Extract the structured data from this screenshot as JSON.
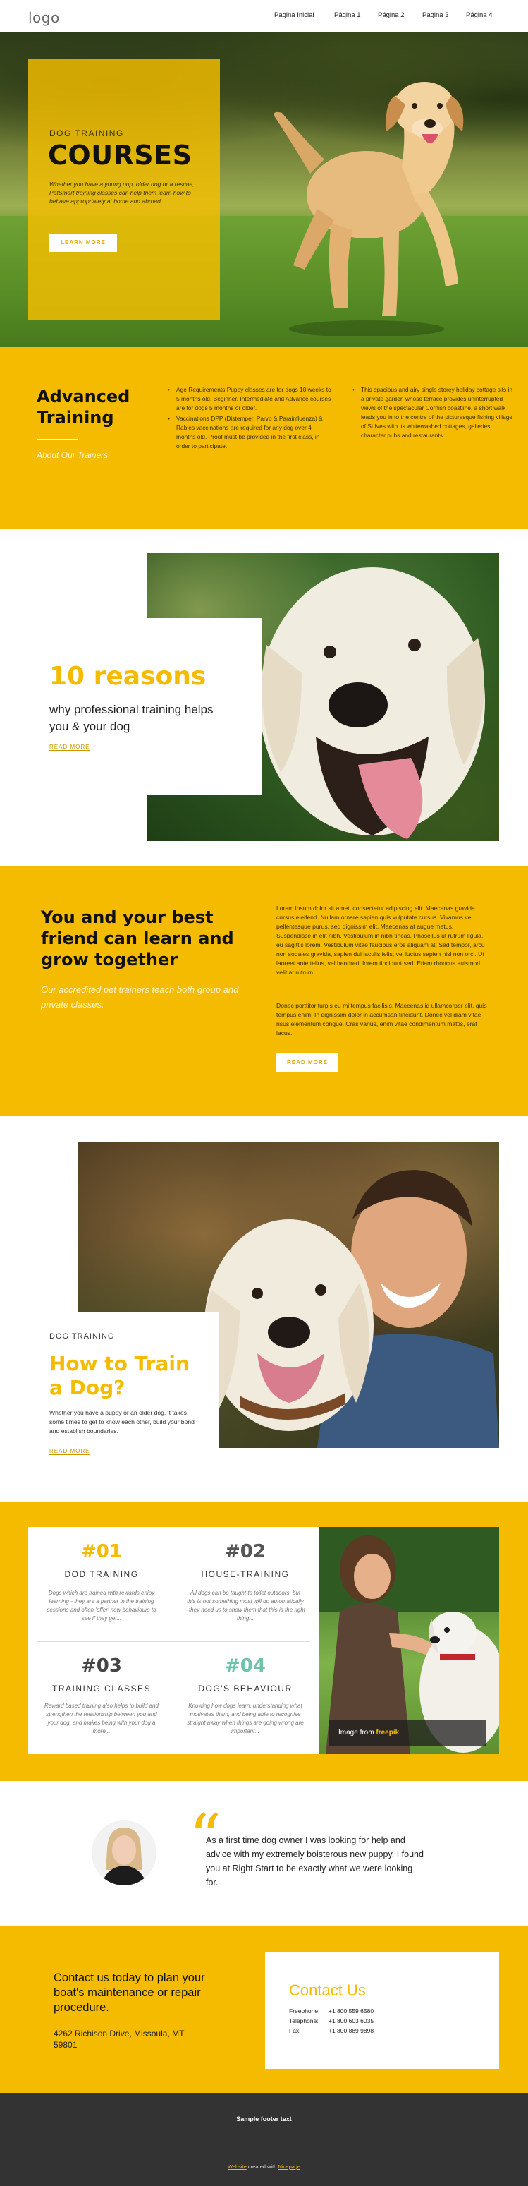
{
  "header": {
    "logo": "logo",
    "nav": [
      "Página Inicial",
      "Página 1",
      "Página 2",
      "Página 3",
      "Página 4"
    ]
  },
  "hero": {
    "eyebrow": "DOG TRAINING",
    "title": "COURSES",
    "text": "Whether you have a young pup, older dog or a rescue, PetSmart training classes can help them learn how to behave appropriately at home and abroad.",
    "button": "LEARN MORE"
  },
  "advanced": {
    "title": "Advanced Training",
    "link": "About Our Trainers",
    "list1": [
      "Age Requirements Puppy classes are for dogs 10 weeks to 5 months old. Beginner, Intermediate and Advance courses are for dogs 5 months or older.",
      "Vaccinations DPP (Distemper, Parvo & Parainfluenza) & Rabies vaccinations are required for any dog over 4 months old. Proof must be provided in the first class, in order to participate."
    ],
    "list2": [
      "This spacious and airy single storey holiday cottage sits in a private garden whose terrace provides uninterrupted views of the spectacular Cornish coastline, a short walk leads you in to the centre of the picturesque fishing village of St Ives with its whitewashed cottages, galleries character pubs and restaurants."
    ]
  },
  "reasons": {
    "title": "10 reasons",
    "text": "why professional training helps you & your dog",
    "link": "READ MORE"
  },
  "learn": {
    "title": "You and your best friend can learn and grow together",
    "subtitle": "Our accredited pet trainers teach both group and private classes.",
    "p1": "Lorem ipsum dolor sit amet, consectetur adipiscing elit. Maecenas gravida cursus eleifend. Nullam ornare sapien quis vulputate cursus. Vivamus vel pellentesque purus, sed dignissim elit. Maecenas at augue metus. Suspendisse in elit nibh. Vestibulum in nibh tincas. Phasellus ut rutrum ligula, eu sagittis lorem. Vestibulum vitae faucibus eros aliquam at. Sed tempor, arcu non sodales gravida, sapien dui iaculis felis, vel luctus sapien nisl non orci. Ut laoreet ante tellus, vel hendrerit lorem tincidunt sed. Etiam rhoncus euismod velit at rutrum.",
    "p2": "Donec porttitor turpis eu mi tempus facilisis. Maecenas id ullamcorper elit, quis tempus enim. In dignissim dolor in accumsan tincidunt. Donec vel diam vitae risus elementum congue. Cras varius, enim vitae condimentum mattis, erat lacus.",
    "button": "READ MORE"
  },
  "train": {
    "eyebrow": "DOG TRAINING",
    "title": "How to Train a Dog?",
    "text": "Whether you have a puppy or an older dog, it takes some times to get to know each other, build your bond and establish boundaries.",
    "link": "READ MORE"
  },
  "features": {
    "items": [
      {
        "num": "#01",
        "head": "DOD TRAINING",
        "text": "Dogs which are trained with rewards enjoy learning - they are a partner in the training sessions and often 'offer' new behaviours to see if they get...",
        "color": "#f5bb00"
      },
      {
        "num": "#02",
        "head": "HOUSE-TRAINING",
        "text": "All dogs can be taught to toilet outdoors, but this is not something most will do automatically - they need us to show them that this is the right thing...",
        "color": "#555555"
      },
      {
        "num": "#03",
        "head": "TRAINING CLASSES",
        "text": "Reward based training also helps to build and strengthen the relationship between you and your dog, and makes being with your dog a more...",
        "color": "#444444"
      },
      {
        "num": "#04",
        "head": "DOG'S BEHAVIOUR",
        "text": "Knowing how dogs learn, understanding what motivates them, and being able to recognise straight away when things are going wrong are important...",
        "color": "#6fc3a8"
      }
    ],
    "caption": "Image from",
    "caption_link": "freepik"
  },
  "testimonial": {
    "quote_mark": "“",
    "text": "As a first time dog owner I was looking for help and advice with my extremely boisterous new puppy. I found you at Right Start to be exactly what we were looking for."
  },
  "contact": {
    "title": "Contact us today to plan your boat's maintenance or repair procedure.",
    "address": "4262 Richison Drive, Missoula, MT 59801",
    "card_title": "Contact Us",
    "rows": [
      {
        "label": "Freephone:",
        "value": "+1 800 559 6580"
      },
      {
        "label": "Telephone:",
        "value": "+1 800 603 6035"
      },
      {
        "label": "Fax:",
        "value": "+1 800 889 9898"
      }
    ]
  },
  "footer": {
    "text": "Sample footer text",
    "credit_link1": "Website",
    "credit_mid": "created with",
    "credit_link2": "Nicepage"
  },
  "colors": {
    "accent": "#f5bb00",
    "footer": "#333333"
  }
}
